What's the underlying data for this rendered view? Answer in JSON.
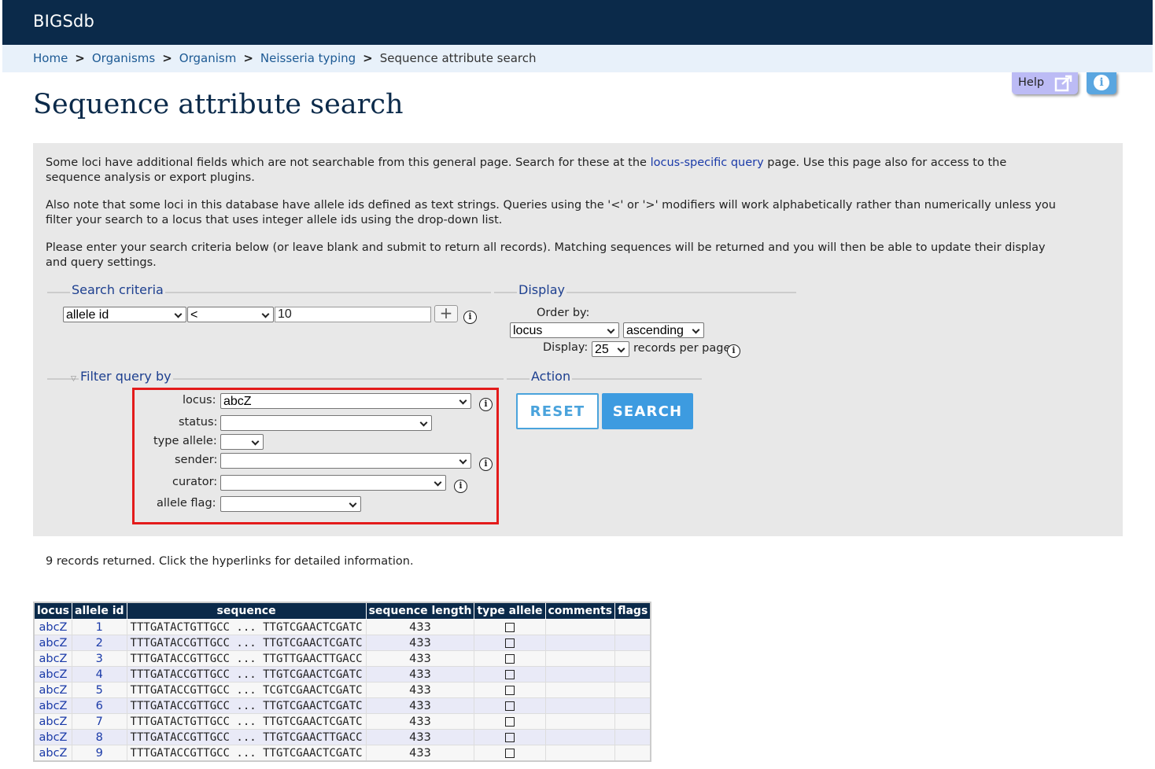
{
  "app": {
    "brand": "BIGSdb"
  },
  "breadcrumb": [
    "Home",
    "Organisms",
    "Organism",
    "Neisseria typing"
  ],
  "breadcrumb_current": "Sequence attribute search",
  "breadcrumb_sep": ">",
  "help_label": "Help",
  "page_title": "Sequence attribute search",
  "intro": {
    "p1_before": "Some loci have additional fields which are not searchable from this general page. Search for these at the ",
    "p1_link": "locus-specific query",
    "p1_after": " page. Use this page also for access to the sequence analysis or export plugins.",
    "p2": "Also note that some loci in this database have allele ids defined as text strings. Queries using the '<' or '>' modifiers will work alphabetically rather than numerically unless you filter your search to a locus that uses integer allele ids using the drop-down list.",
    "p3": "Please enter your search criteria below (or leave blank and submit to return all records). Matching sequences will be returned and you will then be able to update their display and query settings."
  },
  "search_criteria": {
    "legend": "Search criteria",
    "field": "allele id",
    "operator": "<",
    "value": "10",
    "add_label": "+"
  },
  "display": {
    "legend": "Display",
    "order_by_label": "Order by:",
    "order_field": "locus",
    "order_dir": "ascending",
    "display_label": "Display:",
    "per_page": "25",
    "per_page_suffix": "records per page"
  },
  "filter": {
    "legend": "Filter query by",
    "locus_label": "locus:",
    "locus_value": "abcZ",
    "status_label": "status:",
    "status_value": "",
    "type_allele_label": "type allele:",
    "type_allele_value": "",
    "sender_label": "sender:",
    "sender_value": "",
    "curator_label": "curator:",
    "curator_value": "",
    "allele_flag_label": "allele flag:",
    "allele_flag_value": ""
  },
  "action": {
    "legend": "Action",
    "reset_label": "RESET",
    "search_label": "SEARCH"
  },
  "results": {
    "count_text": "9 records returned. Click the hyperlinks for detailed information.",
    "columns": [
      "locus",
      "allele id",
      "sequence",
      "sequence length",
      "type allele",
      "comments",
      "flags"
    ],
    "rows": [
      {
        "locus": "abcZ",
        "allele_id": "1",
        "sequence": "TTTGATACTGTTGCC ... TTGTCGAACTCGATC",
        "length": "433"
      },
      {
        "locus": "abcZ",
        "allele_id": "2",
        "sequence": "TTTGATACCGTTGCC ... TTGTCGAACTCGATC",
        "length": "433"
      },
      {
        "locus": "abcZ",
        "allele_id": "3",
        "sequence": "TTTGATACCGTTGCC ... TTGTTGAACTTGACC",
        "length": "433"
      },
      {
        "locus": "abcZ",
        "allele_id": "4",
        "sequence": "TTTGATACCGTTGCC ... TTGTCGAACTCGATC",
        "length": "433"
      },
      {
        "locus": "abcZ",
        "allele_id": "5",
        "sequence": "TTTGATACCGTTGCC ... TCGTCGAACTCGATC",
        "length": "433"
      },
      {
        "locus": "abcZ",
        "allele_id": "6",
        "sequence": "TTTGATACCGTTGCC ... TTGTCGAACTCGATC",
        "length": "433"
      },
      {
        "locus": "abcZ",
        "allele_id": "7",
        "sequence": "TTTGATACTGTTGCC ... TTGTCGAACTCGATC",
        "length": "433"
      },
      {
        "locus": "abcZ",
        "allele_id": "8",
        "sequence": "TTTGATACCGTTGCC ... TTGTCGAACTTGACC",
        "length": "433"
      },
      {
        "locus": "abcZ",
        "allele_id": "9",
        "sequence": "TTTGATACCGTTGCC ... TTGTCGAACTCGATC",
        "length": "433"
      }
    ]
  },
  "colors": {
    "navy": "#0b2a4a",
    "accent": "#3d9be0",
    "highlight": "#e31b1b"
  }
}
